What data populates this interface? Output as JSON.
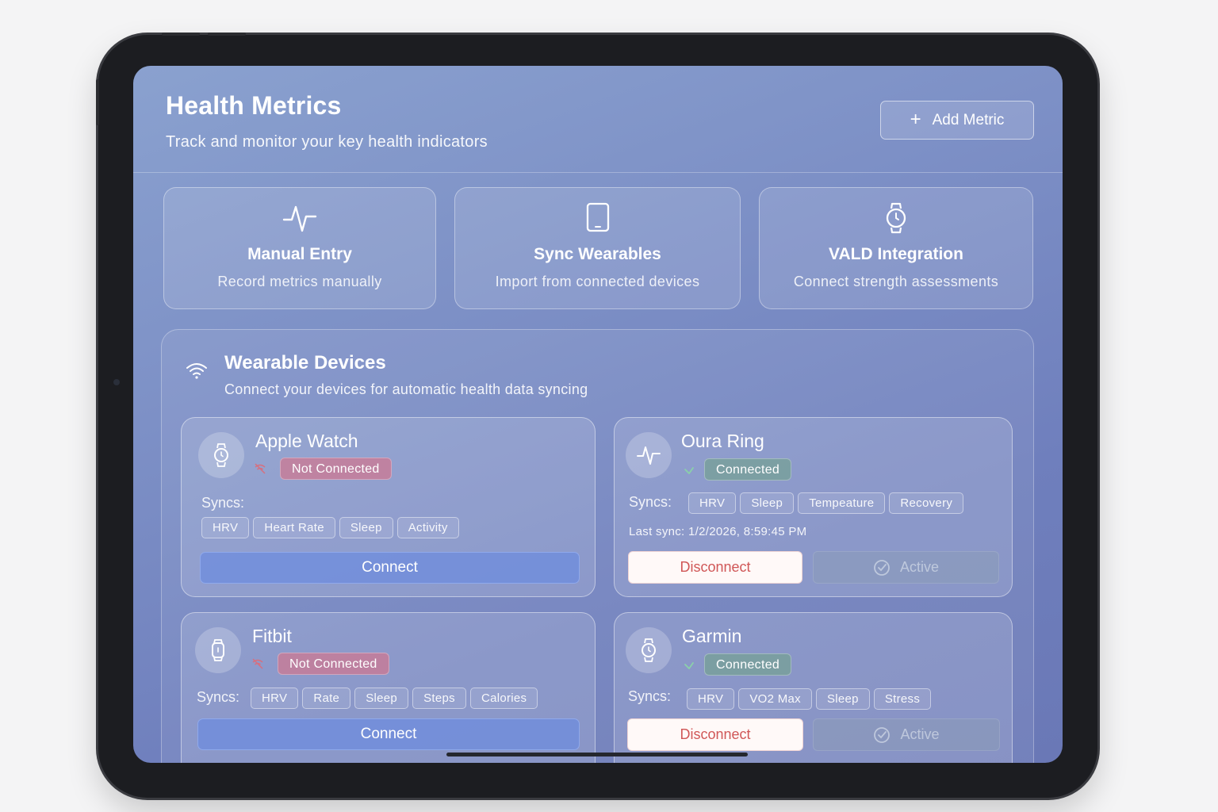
{
  "header": {
    "title": "Health Metrics",
    "subtitle": "Track and monitor your key health indicators",
    "add_button": {
      "icon": "plus-icon",
      "label": "Add Metric"
    }
  },
  "actions": [
    {
      "icon": "pulse-icon",
      "title": "Manual Entry",
      "subtitle": "Record metrics manually"
    },
    {
      "icon": "tablet-icon",
      "title": "Sync Wearables",
      "subtitle": "Import from connected devices"
    },
    {
      "icon": "watch-icon",
      "title": "VALD Integration",
      "subtitle": "Connect strength assessments"
    }
  ],
  "wearables": {
    "icon": "wifi-icon",
    "title": "Wearable Devices",
    "subtitle": "Connect your devices for automatic health data syncing",
    "syncs_label": "Syncs:",
    "devices": [
      {
        "name": "Apple Watch",
        "icon": "watch-icon",
        "status": "Not Connected",
        "tags": [
          "HRV",
          "Heart Rate",
          "Sleep",
          "Activity"
        ],
        "primary_button": "Connect"
      },
      {
        "name": "Oura Ring",
        "icon": "pulse-icon",
        "status": "Connected",
        "tags": [
          "HRV",
          "Sleep",
          "Tempeature",
          "Recovery"
        ],
        "last_sync": "Last sync: 1/2/2026, 8:59:45 PM",
        "disconnect_button": "Disconnect",
        "active_button": "Active"
      },
      {
        "name": "Fitbit",
        "icon": "fitness-band-icon",
        "status": "Not Connected",
        "tags": [
          "HRV",
          "Rate",
          "Sleep",
          "Steps",
          "Calories"
        ],
        "primary_button": "Connect"
      },
      {
        "name": "Garmin",
        "icon": "watch-icon",
        "status": "Connected",
        "tags": [
          "HRV",
          "VO2 Max",
          "Sleep",
          "Stress"
        ],
        "disconnect_button": "Disconnect",
        "active_button": "Active"
      }
    ]
  },
  "colors": {
    "background_start": "#8aa1cf",
    "background_end": "#6a78b6",
    "disconnect_text": "#d05757",
    "connect_button": "#6e8cde"
  }
}
